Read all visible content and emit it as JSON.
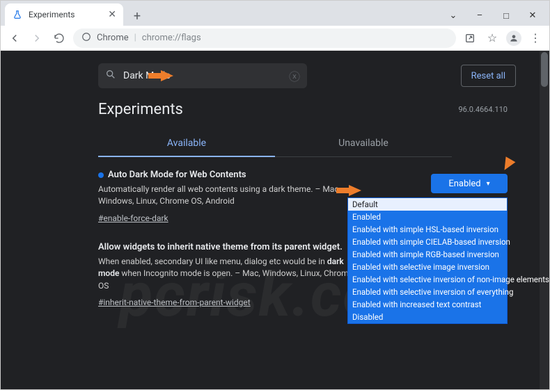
{
  "window": {
    "tab_title": "Experiments",
    "minimize": "–",
    "maximize": "□",
    "close": "✕"
  },
  "toolbar": {
    "omnibox_chip": "Chrome",
    "omnibox_url": "chrome://flags"
  },
  "page": {
    "search_value": "Dark Mode",
    "reset_label": "Reset all",
    "heading": "Experiments",
    "version": "96.0.4664.110",
    "tabs": {
      "available": "Available",
      "unavailable": "Unavailable"
    }
  },
  "flags": [
    {
      "title_pre": "Auto ",
      "title_hl": "Dark Mode",
      "title_post": " for Web Contents",
      "desc": "Automatically render all web contents using a dark theme. – Mac, Windows, Linux, Chrome OS, Android",
      "tag": "#enable-force-dark",
      "select_label": "Enabled",
      "options": [
        "Default",
        "Enabled",
        "Enabled with simple HSL-based inversion",
        "Enabled with simple CIELAB-based inversion",
        "Enabled with simple RGB-based inversion",
        "Enabled with selective image inversion",
        "Enabled with selective inversion of non-image elements",
        "Enabled with selective inversion of everything",
        "Enabled with increased text contrast",
        "Disabled"
      ]
    },
    {
      "title_pre": "Allow widgets to inherit native theme from its parent widget.",
      "title_hl": "",
      "title_post": "",
      "desc_pre": "When enabled, secondary UI like menu, dialog etc would be in ",
      "desc_hl": "dark mode",
      "desc_post": " when Incognito mode is open. – Mac, Windows, Linux, Chrome OS",
      "tag": "#inherit-native-theme-from-parent-widget"
    }
  ],
  "watermark": "pcrisk.com"
}
